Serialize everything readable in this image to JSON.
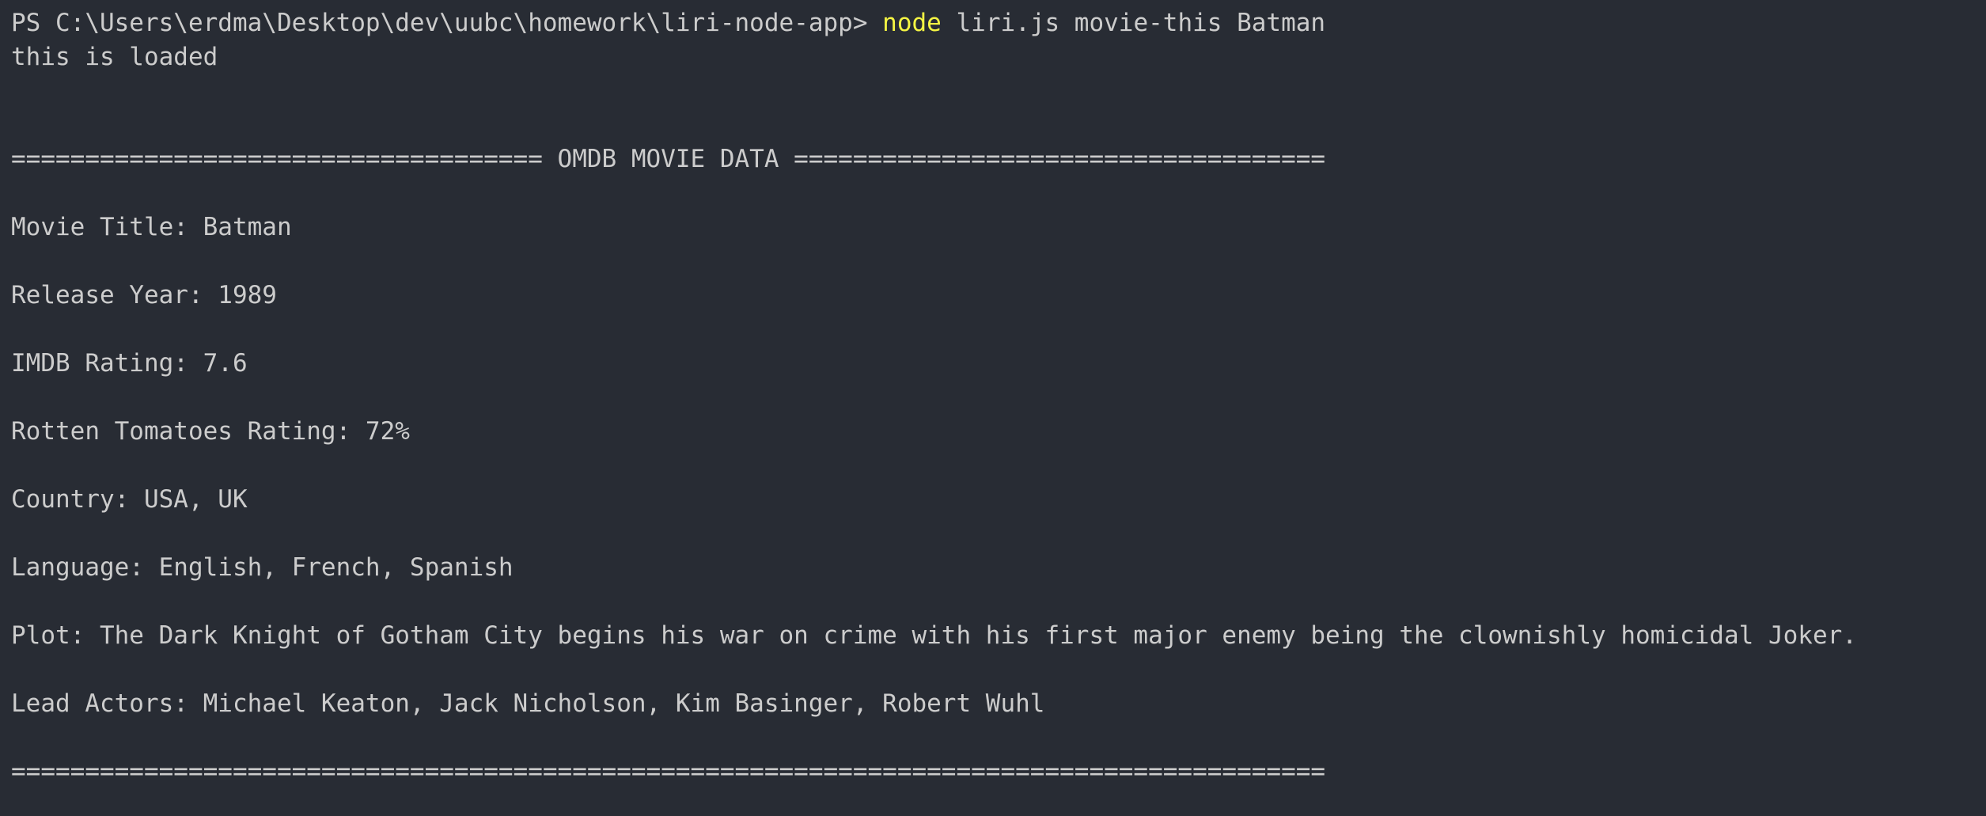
{
  "prompt": {
    "path": "PS C:\\Users\\erdma\\Desktop\\dev\\uubc\\homework\\liri-node-app>",
    "command": "node",
    "args": "liri.js movie-this Batman"
  },
  "output": {
    "loaded": "this is loaded",
    "header": "==================================== OMDB MOVIE DATA ====================================",
    "title": "Movie Title: Batman",
    "year": "Release Year: 1989",
    "imdb": "IMDB Rating: 7.6",
    "rotten": "Rotten Tomatoes Rating: 72%",
    "country": "Country: USA, UK",
    "language": "Language: English, French, Spanish",
    "plot": "Plot: The Dark Knight of Gotham City begins his war on crime with his first major enemy being the clownishly homicidal Joker.",
    "actors": "Lead Actors: Michael Keaton, Jack Nicholson, Kim Basinger, Robert Wuhl",
    "footer": "========================================================================================="
  },
  "colors": {
    "background": "#282c34",
    "text": "#cccccc",
    "command_highlight": "#f5f543"
  }
}
